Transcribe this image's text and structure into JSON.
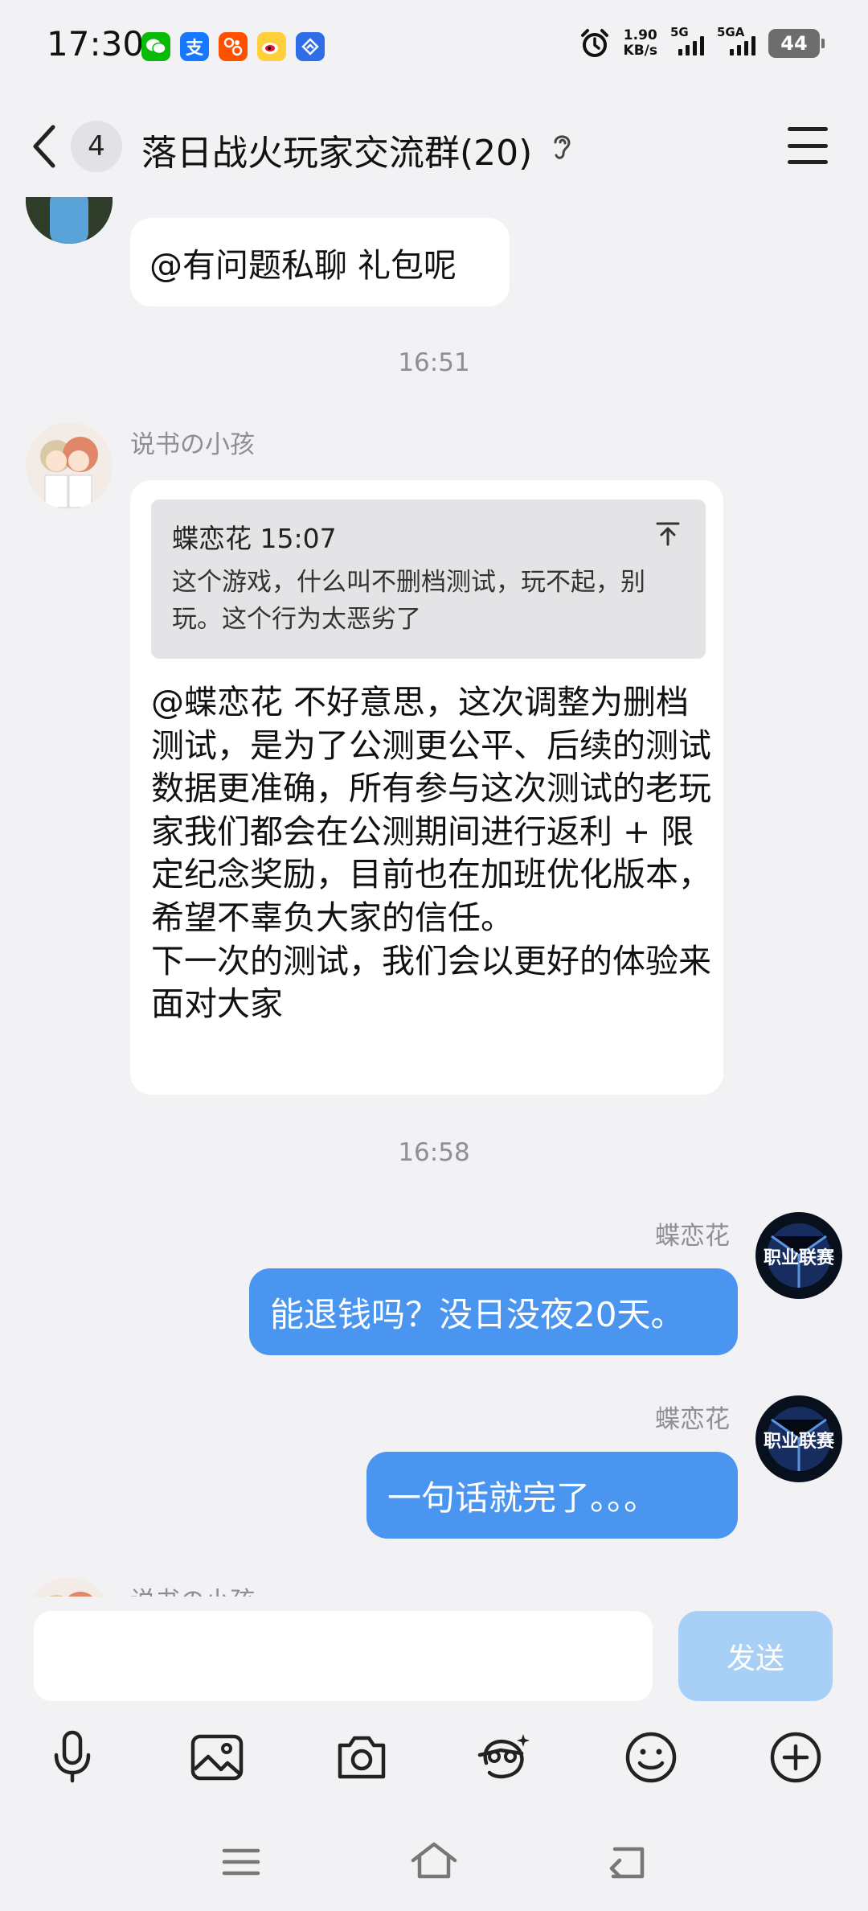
{
  "status_bar": {
    "time": "17:30",
    "net_speed_value": "1.90",
    "net_speed_unit": "KB/s",
    "sim1_label": "5G",
    "sim2_label": "5GA",
    "battery": "44",
    "app_icons": [
      "wechat-icon",
      "alipay-icon",
      "taobao-icon",
      "weibo-icon",
      "app-store-icon"
    ],
    "colors": {
      "wechat": "#09bb07",
      "alipay": "#1677ff",
      "taobao": "#ff5000",
      "weibo": "#ffd03b",
      "app_store": "#2f6de8"
    }
  },
  "header": {
    "unread_count": "4",
    "title": "落日战火玩家交流群(20)"
  },
  "messages": {
    "msg1_text": "@有问题私聊 礼包呢",
    "time1": "16:51",
    "msg2_sender": "说书の小孩",
    "msg2_quote_sender_time": "蝶恋花 15:07",
    "msg2_quote_text": "这个游戏，什么叫不删档测试，玩不起，别玩。这个行为太恶劣了",
    "msg2_text": "@蝶恋花 不好意思，这次调整为删档测试，是为了公测更公平、后续的测试数据更准确，所有参与这次测试的老玩家我们都会在公测期间进行返利 + 限定纪念奖励，目前也在加班优化版本，希望不辜负大家的信任。\n下一次的测试，我们会以更好的体验来面对大家",
    "time2": "16:58",
    "msg3_sender": "蝶恋花",
    "msg3_text": "能退钱吗？没日没夜20天。",
    "msg4_sender": "蝶恋花",
    "msg4_text": "一句话就完了。。。",
    "msg5_sender": "说书の小孩",
    "bubble_out_color": "#4a95f0"
  },
  "input": {
    "value": "",
    "send_label": "发送"
  },
  "toolbar": [
    "microphone-icon",
    "image-icon",
    "camera-icon",
    "sticker-face-icon",
    "emoji-icon",
    "plus-icon"
  ],
  "navbar": [
    "menu-icon",
    "home-icon",
    "back-icon"
  ]
}
